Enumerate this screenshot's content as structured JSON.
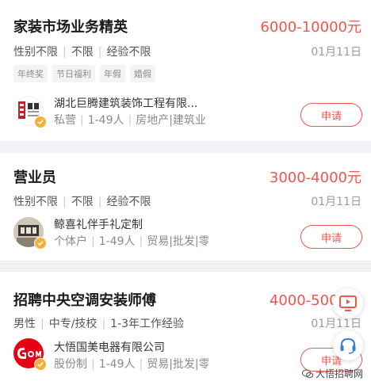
{
  "jobs": [
    {
      "title": "家装市场业务精英",
      "salary": "6000-10000元",
      "reqs": [
        "性别不限",
        "不限",
        "经验不限"
      ],
      "date": "01月11日",
      "tags": [
        "年终奖",
        "节日福利",
        "年假",
        "婚假"
      ],
      "company": "湖北巨腾建筑装饰工程有限...",
      "meta": [
        "私营",
        "1-49人",
        "房地产|建筑业"
      ],
      "apply_label": "申请"
    },
    {
      "title": "营业员",
      "salary": "3000-4000元",
      "reqs": [
        "性别不限",
        "不限",
        "经验不限"
      ],
      "date": "01月11日",
      "company": "鲸喜礼伴手礼定制",
      "meta": [
        "个体户",
        "1-49人",
        "贸易|批发|零售"
      ],
      "apply_label": "申请"
    },
    {
      "title": "招聘中央空调安装师傅",
      "salary": "4000-5000元",
      "reqs": [
        "男性",
        "中专/技校",
        "1-3年工作经验"
      ],
      "date": "01月11日",
      "company": "大悟国美电器有限公司",
      "meta": [
        "股份制",
        "1-49人",
        "贸易|批发|零售"
      ],
      "apply_label": "申请"
    }
  ],
  "logos": {
    "company1_mark": "巨腾装饰",
    "company3_mark": "GOME 国美"
  },
  "floating": {
    "video_icon": "monitor-play-icon",
    "service_icon": "headset-icon"
  },
  "watermark": "大悟招聘网",
  "colors": {
    "accent": "#f2554a",
    "verified": "#f4b23c",
    "background": "#f2f3f7"
  }
}
